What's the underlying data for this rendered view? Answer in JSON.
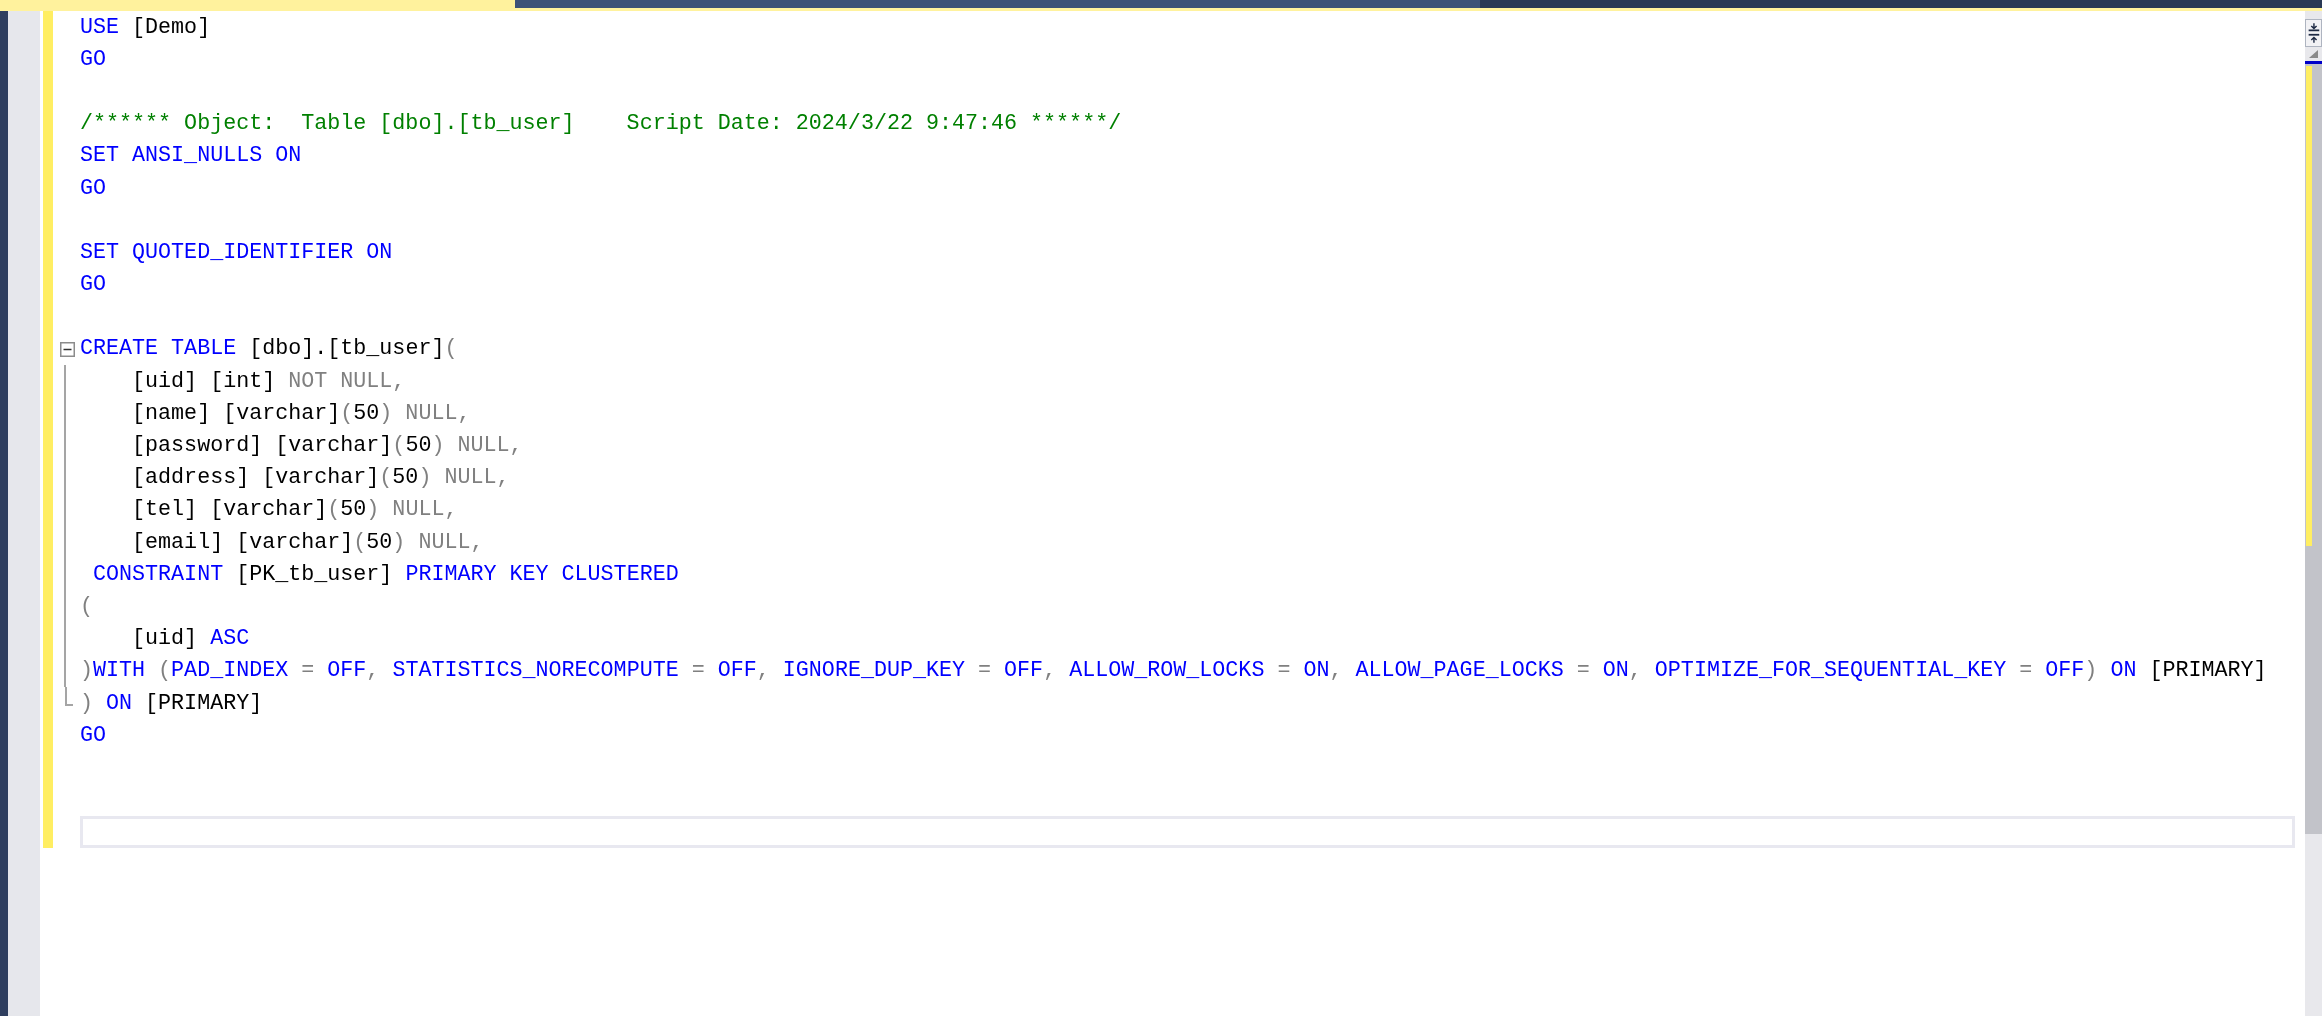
{
  "tabs": [
    {
      "selected": true
    },
    {
      "selected": false
    }
  ],
  "editor": {
    "lines": [
      {
        "kind": "code",
        "current": false,
        "tokens": [
          {
            "kind": "keyword",
            "text": "USE"
          },
          {
            "kind": "plain",
            "text": " [Demo]"
          }
        ]
      },
      {
        "kind": "code",
        "current": false,
        "tokens": [
          {
            "kind": "keyword",
            "text": "GO"
          }
        ]
      },
      {
        "kind": "blank",
        "current": false
      },
      {
        "kind": "code",
        "current": false,
        "tokens": [
          {
            "kind": "comment",
            "text": "/****** Object:  Table [dbo].[tb_user]    Script Date: 2024/3/22 9:47:46 ******/"
          }
        ]
      },
      {
        "kind": "code",
        "current": false,
        "tokens": [
          {
            "kind": "keyword",
            "text": "SET ANSI_NULLS ON"
          }
        ]
      },
      {
        "kind": "code",
        "current": false,
        "tokens": [
          {
            "kind": "keyword",
            "text": "GO"
          }
        ]
      },
      {
        "kind": "blank",
        "current": false
      },
      {
        "kind": "code",
        "current": false,
        "tokens": [
          {
            "kind": "keyword",
            "text": "SET QUOTED_IDENTIFIER ON"
          }
        ]
      },
      {
        "kind": "code",
        "current": false,
        "tokens": [
          {
            "kind": "keyword",
            "text": "GO"
          }
        ]
      },
      {
        "kind": "blank",
        "current": false
      },
      {
        "kind": "code",
        "current": false,
        "expanded": true,
        "tokens": [
          {
            "kind": "keyword",
            "text": "CREATE TABLE"
          },
          {
            "kind": "plain",
            "text": " [dbo].[tb_user]"
          },
          {
            "kind": "operator",
            "text": "("
          }
        ],
        "children": [
          {
            "kind": "code",
            "current": false,
            "tokens": [
              {
                "kind": "plain",
                "text": "    [uid] [int] "
              },
              {
                "kind": "operator",
                "text": "NOT NULL,"
              }
            ]
          },
          {
            "kind": "code",
            "current": false,
            "tokens": [
              {
                "kind": "plain",
                "text": "    [name] [varchar]"
              },
              {
                "kind": "operator",
                "text": "("
              },
              {
                "kind": "plain",
                "text": "50"
              },
              {
                "kind": "operator",
                "text": ") NULL,"
              }
            ]
          },
          {
            "kind": "code",
            "current": false,
            "tokens": [
              {
                "kind": "plain",
                "text": "    [password] [varchar]"
              },
              {
                "kind": "operator",
                "text": "("
              },
              {
                "kind": "plain",
                "text": "50"
              },
              {
                "kind": "operator",
                "text": ") NULL,"
              }
            ]
          },
          {
            "kind": "code",
            "current": false,
            "tokens": [
              {
                "kind": "plain",
                "text": "    [address] [varchar]"
              },
              {
                "kind": "operator",
                "text": "("
              },
              {
                "kind": "plain",
                "text": "50"
              },
              {
                "kind": "operator",
                "text": ") NULL,"
              }
            ]
          },
          {
            "kind": "code",
            "current": false,
            "tokens": [
              {
                "kind": "plain",
                "text": "    [tel] [varchar]"
              },
              {
                "kind": "operator",
                "text": "("
              },
              {
                "kind": "plain",
                "text": "50"
              },
              {
                "kind": "operator",
                "text": ") NULL,"
              }
            ]
          },
          {
            "kind": "code",
            "current": false,
            "tokens": [
              {
                "kind": "plain",
                "text": "    [email] [varchar]"
              },
              {
                "kind": "operator",
                "text": "("
              },
              {
                "kind": "plain",
                "text": "50"
              },
              {
                "kind": "operator",
                "text": ") NULL,"
              }
            ]
          },
          {
            "kind": "code",
            "current": false,
            "tokens": [
              {
                "kind": "keyword",
                "text": " CONSTRAINT"
              },
              {
                "kind": "plain",
                "text": " [PK_tb_user] "
              },
              {
                "kind": "keyword",
                "text": "PRIMARY KEY CLUSTERED"
              }
            ]
          },
          {
            "kind": "code",
            "current": false,
            "tokens": [
              {
                "kind": "operator",
                "text": "("
              }
            ]
          },
          {
            "kind": "code",
            "current": false,
            "tokens": [
              {
                "kind": "plain",
                "text": "    [uid] "
              },
              {
                "kind": "keyword",
                "text": "ASC"
              }
            ]
          },
          {
            "kind": "code",
            "current": false,
            "tokens": [
              {
                "kind": "operator",
                "text": ")"
              },
              {
                "kind": "keyword",
                "text": "WITH "
              },
              {
                "kind": "operator",
                "text": "("
              },
              {
                "kind": "keyword",
                "text": "PAD_INDEX "
              },
              {
                "kind": "operator",
                "text": "= "
              },
              {
                "kind": "keyword",
                "text": "OFF"
              },
              {
                "kind": "operator",
                "text": ", "
              },
              {
                "kind": "keyword",
                "text": "STATISTICS_NORECOMPUTE "
              },
              {
                "kind": "operator",
                "text": "= "
              },
              {
                "kind": "keyword",
                "text": "OFF"
              },
              {
                "kind": "operator",
                "text": ", "
              },
              {
                "kind": "keyword",
                "text": "IGNORE_DUP_KEY "
              },
              {
                "kind": "operator",
                "text": "= "
              },
              {
                "kind": "keyword",
                "text": "OFF"
              },
              {
                "kind": "operator",
                "text": ", "
              },
              {
                "kind": "keyword",
                "text": "ALLOW_ROW_LOCKS "
              },
              {
                "kind": "operator",
                "text": "= "
              },
              {
                "kind": "keyword",
                "text": "ON"
              },
              {
                "kind": "operator",
                "text": ", "
              },
              {
                "kind": "keyword",
                "text": "ALLOW_PAGE_LOCKS "
              },
              {
                "kind": "operator",
                "text": "= "
              },
              {
                "kind": "keyword",
                "text": "ON"
              },
              {
                "kind": "operator",
                "text": ", "
              },
              {
                "kind": "keyword",
                "text": "OPTIMIZE_FOR_SEQUENTIAL_KEY "
              },
              {
                "kind": "operator",
                "text": "= "
              },
              {
                "kind": "keyword",
                "text": "OFF"
              },
              {
                "kind": "operator",
                "text": ") "
              },
              {
                "kind": "keyword",
                "text": "ON "
              },
              {
                "kind": "plain",
                "text": "[PRIMARY]"
              }
            ]
          },
          {
            "kind": "code",
            "current": false,
            "tokens": [
              {
                "kind": "operator",
                "text": ") "
              },
              {
                "kind": "keyword",
                "text": "ON "
              },
              {
                "kind": "plain",
                "text": "[PRIMARY]"
              }
            ]
          }
        ]
      },
      {
        "kind": "code",
        "current": false,
        "tokens": [
          {
            "kind": "keyword",
            "text": "GO"
          }
        ]
      },
      {
        "kind": "blank",
        "current": false
      },
      {
        "kind": "blank",
        "current": false
      },
      {
        "kind": "blank",
        "current": true
      }
    ]
  }
}
